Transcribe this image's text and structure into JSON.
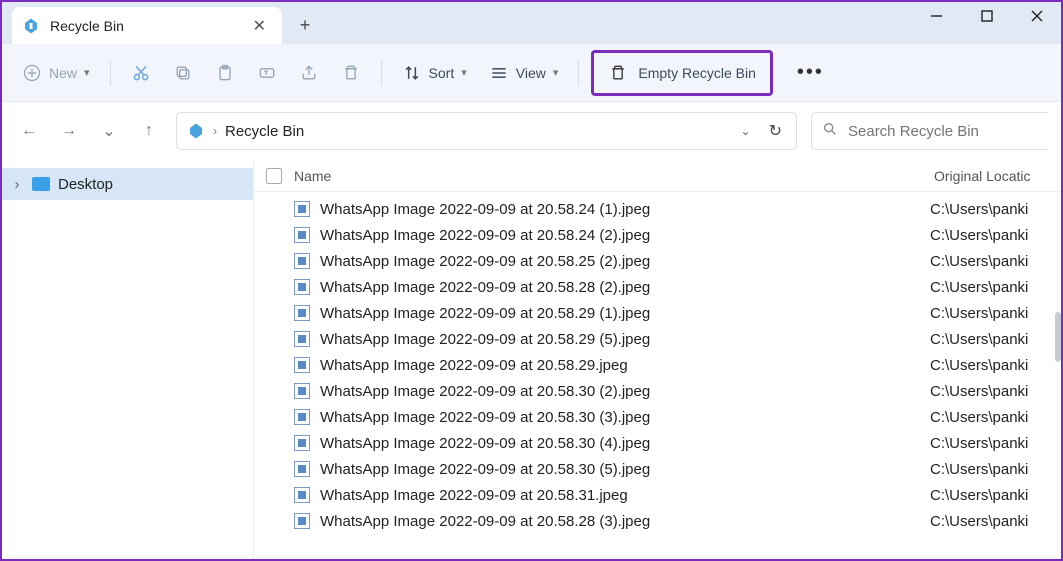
{
  "tab": {
    "title": "Recycle Bin"
  },
  "toolbar": {
    "new_label": "New",
    "sort_label": "Sort",
    "view_label": "View",
    "empty_label": "Empty Recycle Bin"
  },
  "address": {
    "path": "Recycle Bin"
  },
  "search": {
    "placeholder": "Search Recycle Bin"
  },
  "sidebar": {
    "items": [
      {
        "label": "Desktop"
      }
    ]
  },
  "columns": {
    "name": "Name",
    "location": "Original Locatic"
  },
  "files": [
    {
      "name": "WhatsApp Image 2022-09-09 at 20.58.24 (1).jpeg",
      "location": "C:\\Users\\panki"
    },
    {
      "name": "WhatsApp Image 2022-09-09 at 20.58.24 (2).jpeg",
      "location": "C:\\Users\\panki"
    },
    {
      "name": "WhatsApp Image 2022-09-09 at 20.58.25 (2).jpeg",
      "location": "C:\\Users\\panki"
    },
    {
      "name": "WhatsApp Image 2022-09-09 at 20.58.28 (2).jpeg",
      "location": "C:\\Users\\panki"
    },
    {
      "name": "WhatsApp Image 2022-09-09 at 20.58.29 (1).jpeg",
      "location": "C:\\Users\\panki"
    },
    {
      "name": "WhatsApp Image 2022-09-09 at 20.58.29 (5).jpeg",
      "location": "C:\\Users\\panki"
    },
    {
      "name": "WhatsApp Image 2022-09-09 at 20.58.29.jpeg",
      "location": "C:\\Users\\panki"
    },
    {
      "name": "WhatsApp Image 2022-09-09 at 20.58.30 (2).jpeg",
      "location": "C:\\Users\\panki"
    },
    {
      "name": "WhatsApp Image 2022-09-09 at 20.58.30 (3).jpeg",
      "location": "C:\\Users\\panki"
    },
    {
      "name": "WhatsApp Image 2022-09-09 at 20.58.30 (4).jpeg",
      "location": "C:\\Users\\panki"
    },
    {
      "name": "WhatsApp Image 2022-09-09 at 20.58.30 (5).jpeg",
      "location": "C:\\Users\\panki"
    },
    {
      "name": "WhatsApp Image 2022-09-09 at 20.58.31.jpeg",
      "location": "C:\\Users\\panki"
    },
    {
      "name": "WhatsApp Image 2022-09-09 at 20.58.28 (3).jpeg",
      "location": "C:\\Users\\panki"
    }
  ]
}
